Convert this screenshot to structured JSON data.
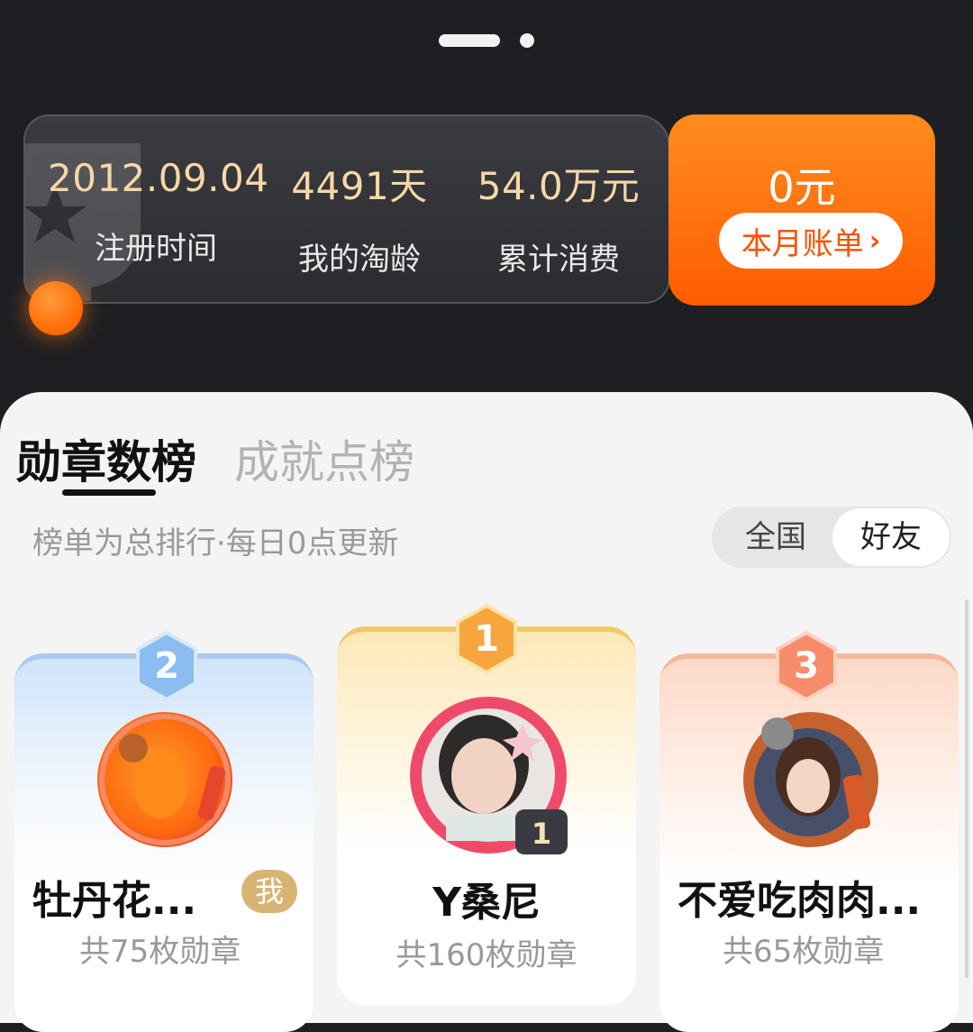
{
  "stats": [
    {
      "value": "2012.09.04",
      "label": "注册时间"
    },
    {
      "value": "4491天",
      "label": "我的淘龄"
    },
    {
      "value": "54.0万元",
      "label": "累计消费"
    }
  ],
  "bill": {
    "amount": "0元",
    "button_label": "本月账单"
  },
  "tabs": [
    {
      "label": "勋章数榜",
      "active": true
    },
    {
      "label": "成就点榜",
      "active": false
    }
  ],
  "subtitle": "榜单为总排行·每日0点更新",
  "scope": {
    "options": [
      "全国",
      "好友"
    ],
    "selected": "好友"
  },
  "ranking": [
    {
      "rank": "2",
      "name": "牡丹花...",
      "badge": "我",
      "count": "共75枚勋章"
    },
    {
      "rank": "1",
      "name": "Y桑尼",
      "count": "共160枚勋章",
      "avatar_badge": "1"
    },
    {
      "rank": "3",
      "name": "不爱吃肉肉...",
      "count": "共65枚勋章"
    }
  ],
  "colors": {
    "accent": "#ff5c00",
    "gold_text": "#f7d7a6",
    "me_badge": "#d8b474"
  }
}
